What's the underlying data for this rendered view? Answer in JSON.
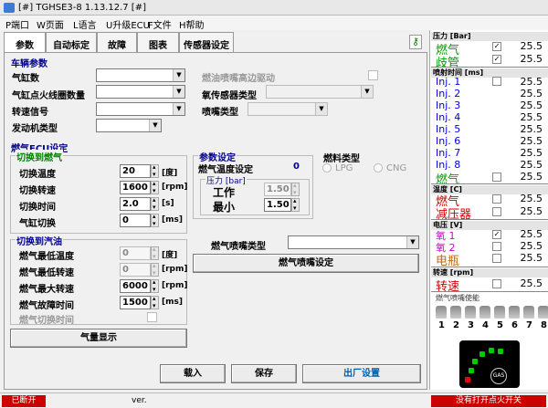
{
  "window": {
    "title": "[#] TGHSE3-8    1.13.12.7   [#]"
  },
  "menu": [
    "P端口",
    "W页面",
    "L语言",
    "U升级ECU",
    "F文件",
    "H帮助"
  ],
  "tabs": [
    "参数",
    "自动标定",
    "故障",
    "图表",
    "传感器设定"
  ],
  "vehicle": {
    "section": "车辆参数",
    "cylinders": "气缸数",
    "ignition": "气缸点火线圈数量",
    "rpm_signal": "转速信号",
    "engine_type": "发动机类型",
    "injector_drive": "燃油喷嘴高边驱动",
    "o2_sensor": "氧传感器类型",
    "nozzle_type": "喷嘴类型"
  },
  "ecu": {
    "section": "燃气ECU设定",
    "to_gas": "切换到燃气",
    "switch_temp": "切换温度",
    "switch_temp_val": "20",
    "switch_temp_unit": "[度]",
    "switch_rpm": "切换转速",
    "switch_rpm_val": "1600",
    "switch_rpm_unit": "[rpm]",
    "switch_time": "切换时间",
    "switch_time_val": "2.0",
    "switch_time_unit": "[s]",
    "cyl_switch": "气缸切换",
    "cyl_switch_val": "0",
    "cyl_switch_unit": "[ms]",
    "to_petrol": "切换到汽油",
    "min_temp": "燃气最低温度",
    "min_temp_val": "0",
    "min_temp_unit": "[度]",
    "min_rpm": "燃气最低转速",
    "min_rpm_val": "0",
    "min_rpm_unit": "[rpm]",
    "max_rpm": "燃气最大转速",
    "max_rpm_val": "6000",
    "max_rpm_unit": "[rpm]",
    "fault_time": "燃气故障时间",
    "fault_time_val": "1500",
    "fault_time_unit": "[ms]",
    "switch_petrol_time": "燃气切换时间",
    "gas_display": "气量显示"
  },
  "params": {
    "section": "参数设定",
    "gas_temp": "燃气温度设定",
    "gas_temp_val": "0",
    "pressure_group": "压力 [bar]",
    "work": "工作",
    "work_val": "1.50",
    "min": "最小",
    "min_val": "1.50"
  },
  "fuel": {
    "section": "燃料类型",
    "lpg": "LPG",
    "cng": "CNG"
  },
  "nozzle": {
    "type_label": "燃气喷嘴类型",
    "settings_btn": "燃气喷嘴设定"
  },
  "buttons": {
    "load": "载入",
    "save": "保存",
    "factory": "出厂设置"
  },
  "right": {
    "pressure_header": "压力 [Bar]",
    "gas": "燃气",
    "gas_val": "25.5",
    "manifold": "歧管",
    "manifold_val": "25.5",
    "inj_header": "喷射时间 [ms]",
    "inj": [
      "Inj. 1",
      "Inj. 2",
      "Inj. 3",
      "Inj. 4",
      "Inj. 5",
      "Inj. 6",
      "Inj. 7",
      "Inj. 8"
    ],
    "inj_val": "25.5",
    "inj_gas": "燃气",
    "inj_gas_val": "25.5",
    "temp_header": "温度 [C]",
    "t_gas": "燃气",
    "t_gas_val": "25.5",
    "t_reducer": "减压器",
    "t_reducer_val": "25.5",
    "volt_header": "电压 [V]",
    "o2_1": "氧 1",
    "o2_1_val": "25.5",
    "o2_2": "氧 2",
    "o2_2_val": "25.5",
    "battery": "电瓶",
    "battery_val": "25.5",
    "rpm_header": "转速 [rpm]",
    "rpm": "转速",
    "rpm_val": "25.5",
    "nozzle_header": "燃气喷嘴使能",
    "nozzle_nums": [
      "1",
      "2",
      "3",
      "4",
      "5",
      "6",
      "7",
      "8"
    ],
    "gauge_text": "GAS"
  },
  "status": {
    "left": "已断开",
    "ver": "ver.",
    "right": "没有打开点火开关"
  },
  "colors": {
    "gas": "#00a000",
    "manifold": "#00a000",
    "inj": "#0000dd",
    "temp": "#cc0000",
    "o2": "#cc00cc",
    "battery": "#cc6600",
    "rpm": "#cc0000",
    "status_red": "#cc0000",
    "label_blue": "#00008b"
  }
}
